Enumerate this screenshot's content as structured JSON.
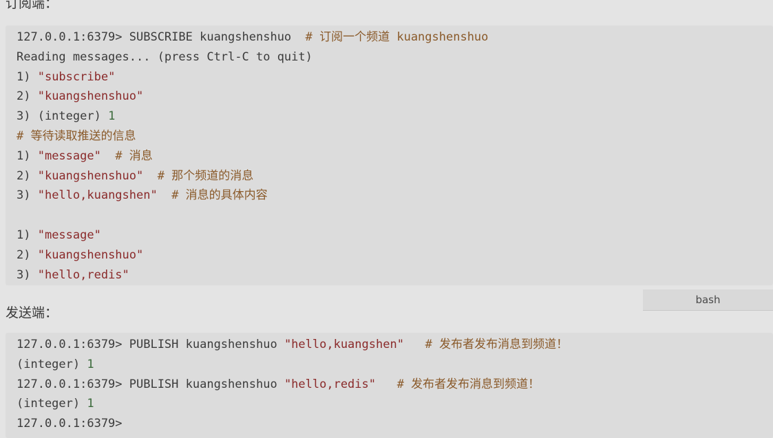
{
  "subscriber_label": "订阅端：",
  "publisher_label": "发送端：",
  "lang_tag": "bash",
  "subscriber_block": {
    "lines": [
      {
        "text": "127.0.0.1:6379> SUBSCRIBE kuangshenshuo  ",
        "comment": "# 订阅一个频道 kuangshenshuo"
      },
      {
        "text": "Reading messages... (press Ctrl-C to quit)"
      },
      {
        "text": "1) ",
        "str": "\"subscribe\""
      },
      {
        "text": "2) ",
        "str": "\"kuangshenshuo\""
      },
      {
        "text": "3) (integer) ",
        "num": "1"
      },
      {
        "comment": "# 等待读取推送的信息"
      },
      {
        "text": "1) ",
        "str": "\"message\"",
        "comment": "  # 消息"
      },
      {
        "text": "2) ",
        "str": "\"kuangshenshuo\"",
        "comment": "  # 那个频道的消息"
      },
      {
        "text": "3) ",
        "str": "\"hello,kuangshen\"",
        "comment": "  # 消息的具体内容"
      },
      {
        "text": ""
      },
      {
        "text": "1) ",
        "str": "\"message\""
      },
      {
        "text": "2) ",
        "str": "\"kuangshenshuo\""
      },
      {
        "text": "3) ",
        "str": "\"hello,redis\""
      }
    ]
  },
  "publisher_block": {
    "lines": [
      {
        "text": "127.0.0.1:6379> PUBLISH kuangshenshuo ",
        "str": "\"hello,kuangshen\"",
        "comment": "   # 发布者发布消息到频道！"
      },
      {
        "text": "(integer) ",
        "num": "1"
      },
      {
        "text": "127.0.0.1:6379> PUBLISH kuangshenshuo ",
        "str": "\"hello,redis\"",
        "comment": "   # 发布者发布消息到频道！"
      },
      {
        "text": "(integer) ",
        "num": "1"
      },
      {
        "text": "127.0.0.1:6379>"
      }
    ]
  }
}
